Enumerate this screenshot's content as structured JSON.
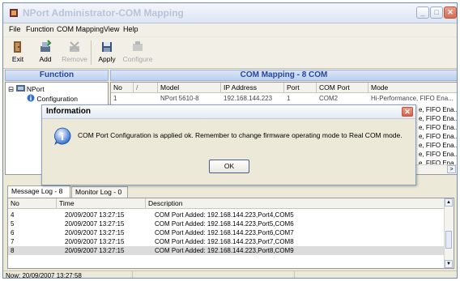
{
  "window": {
    "title": "NPort Administrator-COM Mapping",
    "min_glyph": "_",
    "max_glyph": "□",
    "close_glyph": "✕"
  },
  "menu": {
    "file": "File",
    "function": "Function",
    "com_mapping": "COM Mapping",
    "view": "View",
    "help": "Help"
  },
  "toolbar": {
    "exit": "Exit",
    "add": "Add",
    "remove": "Remove",
    "apply": "Apply",
    "configure": "Configure"
  },
  "function_panel": {
    "header": "Function",
    "tree": [
      {
        "label": "NPort",
        "expander": "⊟"
      },
      {
        "label": "Configuration"
      }
    ]
  },
  "mapping_panel": {
    "header": "COM Mapping - 8 COM",
    "columns": [
      "No",
      "/",
      "Model",
      "IP Address",
      "Port",
      "COM Port",
      "Mode"
    ],
    "first_row": {
      "no": "1",
      "model": "NPort 5610-8",
      "ip": "192.168.144.223",
      "port": "1",
      "com": "COM2",
      "mode": "Hi-Performance, FIFO Ena..."
    },
    "mode_fragments": [
      "e, FIFO Ena...",
      "e, FIFO Ena...",
      "e, FIFO Ena...",
      "e, FIFO Ena...",
      "e, FIFO Ena...",
      "e, FIFO Ena...",
      "e, FIFO Ena..."
    ],
    "scroll_right": ">"
  },
  "log": {
    "tabs": [
      "Message Log - 8",
      "Monitor Log - 0"
    ],
    "columns": [
      "No",
      "Time",
      "Description"
    ],
    "rows": [
      {
        "no": "4",
        "time": "20/09/2007 13:27:15",
        "desc": "COM Port Added: 192.168.144.223,Port4,COM5"
      },
      {
        "no": "5",
        "time": "20/09/2007 13:27:15",
        "desc": "COM Port Added: 192.168.144.223,Port5,COM6"
      },
      {
        "no": "6",
        "time": "20/09/2007 13:27:15",
        "desc": "COM Port Added: 192.168.144.223,Port6,COM7"
      },
      {
        "no": "7",
        "time": "20/09/2007 13:27:15",
        "desc": "COM Port Added: 192.168.144.223,Port7,COM8"
      },
      {
        "no": "8",
        "time": "20/09/2007 13:27:15",
        "desc": "COM Port Added: 192.168.144.223,Port8,COM9"
      }
    ],
    "scroll_up": "▲",
    "scroll_down": "▼"
  },
  "status": {
    "now": "Now: 20/09/2007 13:27:58"
  },
  "dialog": {
    "title": "Information",
    "close_glyph": "✕",
    "message": "COM Port Configuration is applied ok. Remember to change firmware operating mode to Real COM mode.",
    "ok": "OK",
    "icon_glyph": "i"
  },
  "colors": {
    "accent_header": "#2a45a0",
    "info_icon": "#2f6fd0",
    "close_red": "#d56d55"
  }
}
